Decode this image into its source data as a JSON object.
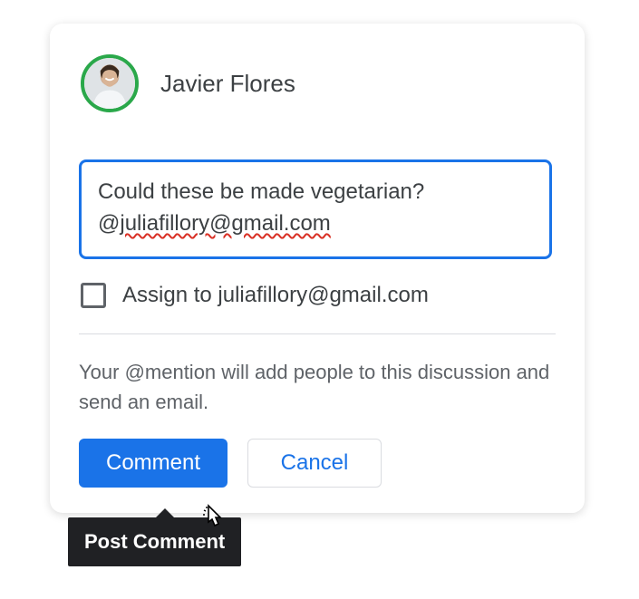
{
  "user": {
    "name": "Javier Flores"
  },
  "comment": {
    "text_line1": "Could these be made vegetarian?",
    "mention_prefix": "@",
    "mention_email": "juliafillory@gmail.com"
  },
  "assign": {
    "checked": false,
    "label": "Assign to juliafillory@gmail.com"
  },
  "help": {
    "text": "Your @mention will add people to this discussion and send an email."
  },
  "buttons": {
    "primary": "Comment",
    "secondary": "Cancel"
  },
  "tooltip": {
    "text": "Post Comment"
  }
}
